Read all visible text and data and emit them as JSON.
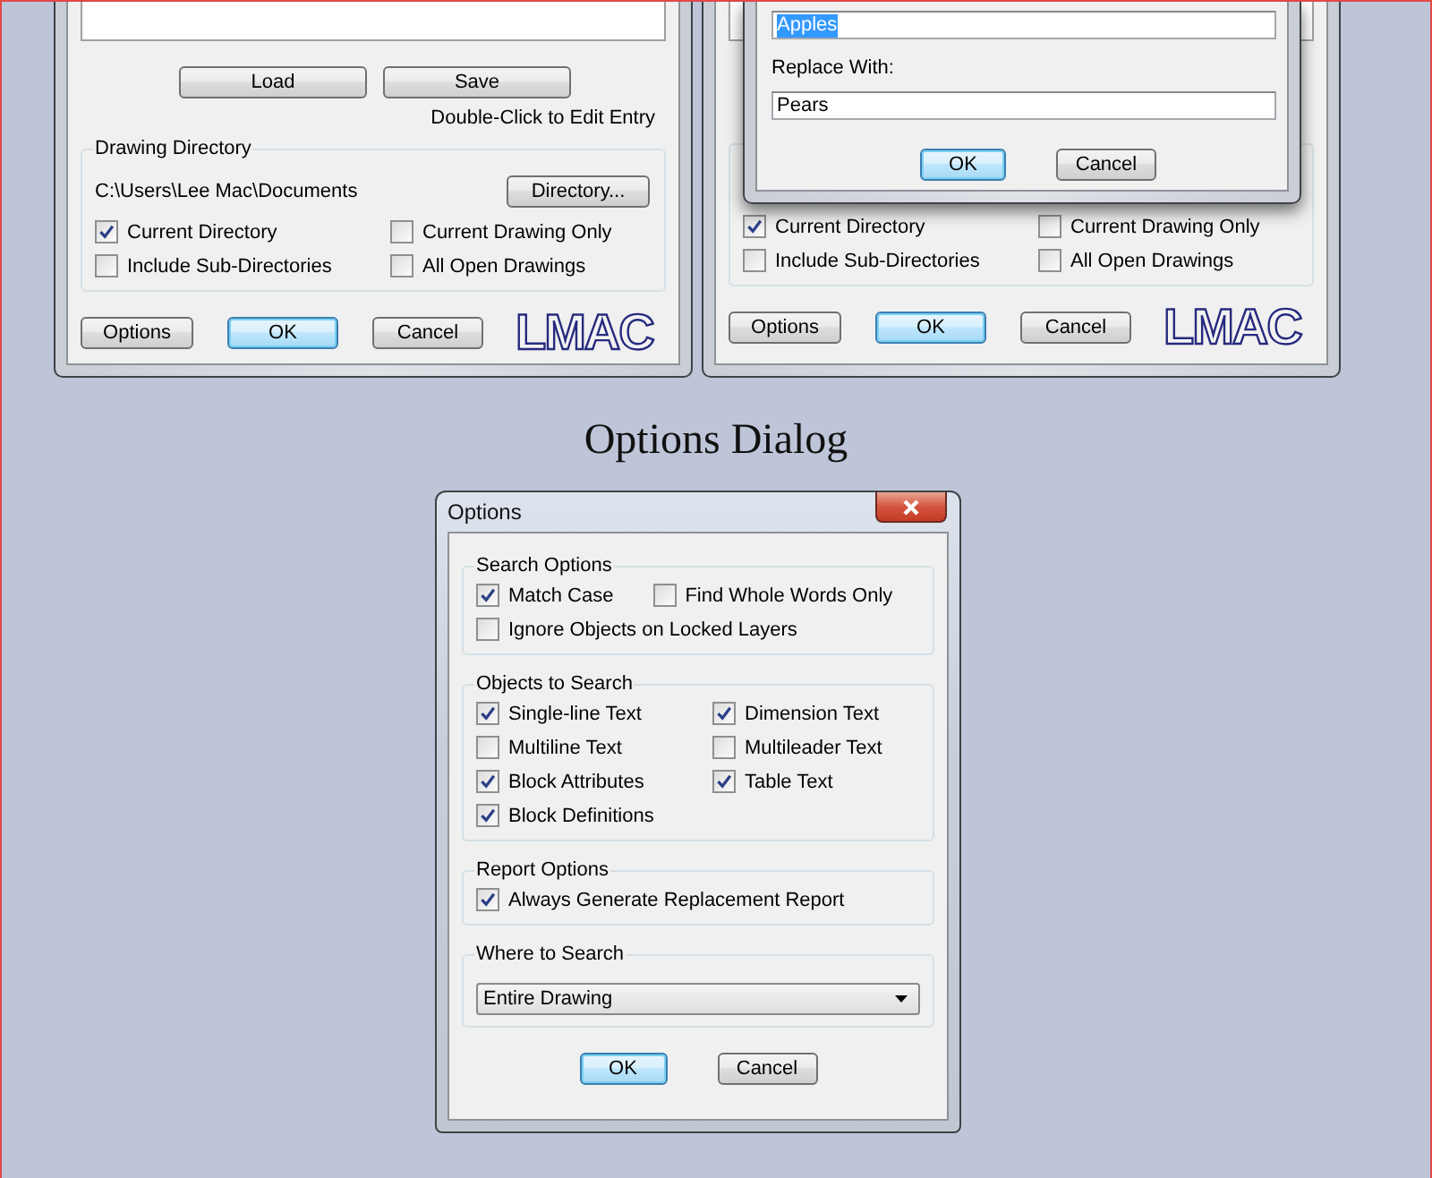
{
  "dialogs": [
    {
      "top_buttons": [
        {
          "label": "Load",
          "default": false
        },
        {
          "label": "Save",
          "default": false
        }
      ],
      "hint": "Double-Click to Edit Entry",
      "directory_group": {
        "title": "Drawing Directory",
        "path": "C:\\Users\\Lee Mac\\Documents",
        "button": "Directory...",
        "checkboxes": [
          {
            "label": "Current Directory",
            "checked": true
          },
          {
            "label": "Current Drawing Only",
            "checked": false
          },
          {
            "label": "Include Sub-Directories",
            "checked": false
          },
          {
            "label": "All Open Drawings",
            "checked": false
          }
        ]
      },
      "buttons": [
        {
          "label": "Options",
          "default": false
        },
        {
          "label": "OK",
          "default": true
        },
        {
          "label": "Cancel",
          "default": false
        }
      ],
      "logo": "LMAC"
    },
    {
      "directory_group": {
        "checkboxes": [
          {
            "label": "Current Directory",
            "checked": true
          },
          {
            "label": "Current Drawing Only",
            "checked": false
          },
          {
            "label": "Include Sub-Directories",
            "checked": false
          },
          {
            "label": "All Open Drawings",
            "checked": false
          }
        ]
      },
      "buttons": [
        {
          "label": "Options",
          "default": false
        },
        {
          "label": "OK",
          "default": true
        },
        {
          "label": "Cancel",
          "default": false
        }
      ],
      "logo": "LMAC",
      "popup": {
        "find_field": {
          "value": "Apples",
          "selected": true
        },
        "replace_label": "Replace With:",
        "replace_field": {
          "value": "Pears",
          "selected": false
        },
        "buttons": [
          {
            "label": "OK",
            "default": true
          },
          {
            "label": "Cancel",
            "default": false
          }
        ]
      }
    }
  ],
  "heading": "Options Dialog",
  "options_dialog": {
    "title": "Options",
    "groups": [
      {
        "kind": "flow",
        "title": "Search Options",
        "rows": [
          [
            {
              "label": "Match Case",
              "checked": true
            },
            {
              "label": "Find Whole Words Only",
              "checked": false
            }
          ],
          [
            {
              "label": "Ignore Objects on Locked Layers",
              "checked": false
            }
          ]
        ]
      },
      {
        "kind": "grid",
        "title": "Objects to Search",
        "items": [
          {
            "label": "Single-line Text",
            "checked": true
          },
          {
            "label": "Dimension Text",
            "checked": true
          },
          {
            "label": "Multiline Text",
            "checked": false
          },
          {
            "label": "Multileader Text",
            "checked": false
          },
          {
            "label": "Block Attributes",
            "checked": true
          },
          {
            "label": "Table Text",
            "checked": true
          },
          {
            "label": "Block Definitions",
            "checked": true
          }
        ]
      },
      {
        "kind": "flow",
        "title": "Report Options",
        "rows": [
          [
            {
              "label": "Always Generate Replacement Report",
              "checked": true
            }
          ]
        ]
      },
      {
        "kind": "combo",
        "title": "Where to Search",
        "value": "Entire Drawing"
      }
    ],
    "buttons": [
      {
        "label": "OK",
        "default": true
      },
      {
        "label": "Cancel",
        "default": false
      }
    ]
  }
}
